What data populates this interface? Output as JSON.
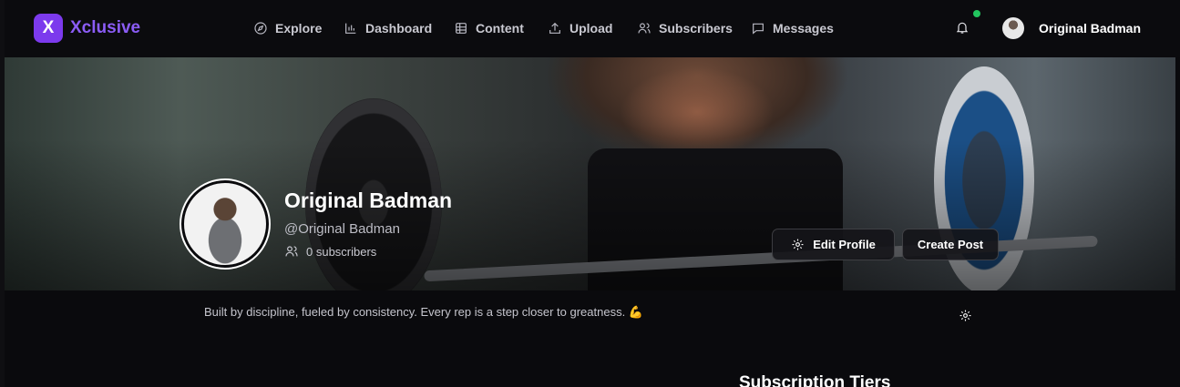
{
  "brand": {
    "logo_letter": "X",
    "name": "Xclusive",
    "accent": "#7c3aed"
  },
  "nav": {
    "items": [
      {
        "label": "Explore",
        "icon": "compass-icon"
      },
      {
        "label": "Dashboard",
        "icon": "bar-chart-icon"
      },
      {
        "label": "Content",
        "icon": "grid-icon"
      },
      {
        "label": "Upload",
        "icon": "upload-icon"
      },
      {
        "label": "Subscribers",
        "icon": "users-icon"
      },
      {
        "label": "Messages",
        "icon": "message-icon"
      }
    ],
    "notification_icon": "bell-icon",
    "notification_dot_color": "#22c55e",
    "user_name": "Original Badman"
  },
  "profile": {
    "name": "Original Badman",
    "handle": "@Original Badman",
    "subscribers": "0 subscribers",
    "edit_label": "Edit Profile",
    "create_label": "Create Post",
    "bio": "Built by discipline, fueled by consistency. Every rep is a step closer to greatness. 💪"
  },
  "sections": {
    "tiers_title": "Subscription Tiers"
  }
}
